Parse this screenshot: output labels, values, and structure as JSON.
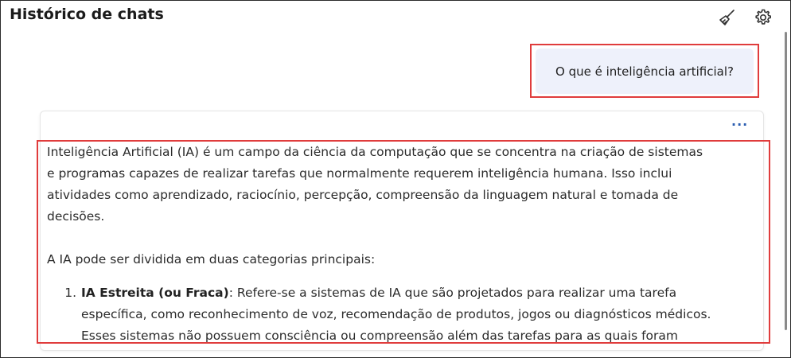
{
  "header": {
    "title": "Histórico de chats",
    "icons": [
      "broom-icon",
      "gear-icon"
    ]
  },
  "user_message": "O que é inteligência artificial?",
  "assistant": {
    "more_label": "···",
    "paragraph1_line1": "Inteligência Artificial (IA) é um campo da ciência da computação que se concentra na criação de sistemas",
    "paragraph1_line2": "e programas capazes de realizar tarefas que normalmente requerem inteligência humana. Isso inclui",
    "paragraph1_line3": "atividades como aprendizado, raciocínio, percepção, compreensão da linguagem natural e tomada de",
    "paragraph1_line4": "decisões.",
    "paragraph2": "A IA pode ser dividida em duas categorias principais:",
    "list": [
      {
        "number": "1.",
        "bold": "IA Estreita (ou Fraca)",
        "line1": ": Refere-se a sistemas de IA que são projetados para realizar uma tarefa",
        "line2": "específica, como reconhecimento de voz, recomendação de produtos, jogos ou diagnósticos médicos.",
        "line3": "Esses sistemas não possuem consciência ou compreensão além das tarefas para as quais foram"
      }
    ]
  },
  "colors": {
    "highlight_border": "#e03c3c",
    "user_bubble_bg": "#eef1fb",
    "more_icon": "#2a5db0"
  }
}
